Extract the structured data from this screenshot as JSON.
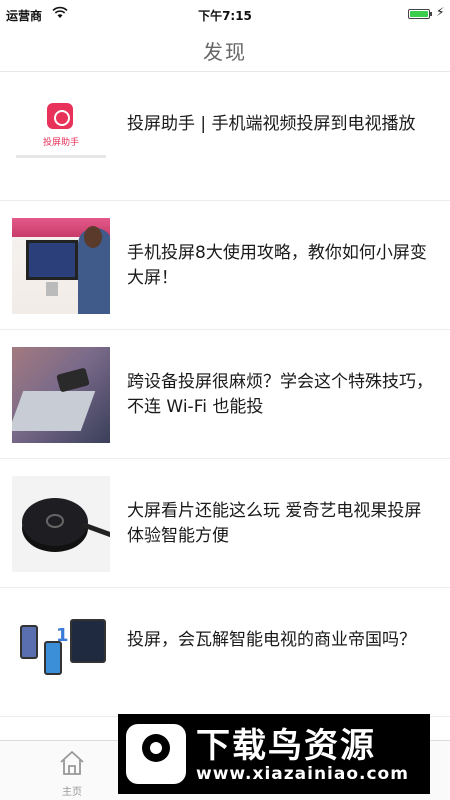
{
  "status_bar": {
    "carrier": "运营商",
    "time": "下午7:15",
    "battery_level": 1.0
  },
  "nav": {
    "title": "发现"
  },
  "articles": [
    {
      "title": "投屏助手 | 手机端视频投屏到电视播放",
      "thumb_label": "投屏助手"
    },
    {
      "title": "手机投屏8大使用攻略，教你如何小屏变大屏！"
    },
    {
      "title": "跨设备投屏很麻烦？学会这个特殊技巧，不连 Wi-Fi 也能投"
    },
    {
      "title": "大屏看片还能这么玩 爱奇艺电视果投屏体验智能方便"
    },
    {
      "title": "投屏，会瓦解智能电视的商业帝国吗？",
      "thumb_label": "1"
    }
  ],
  "tab_bar": {
    "home_label": "主页",
    "home_icon": "home-icon"
  },
  "watermark": {
    "title": "下载鸟资源",
    "url": "www.xiazainiao.com"
  },
  "colors": {
    "accent": "#e8325a",
    "battery": "#3ccf4e"
  }
}
